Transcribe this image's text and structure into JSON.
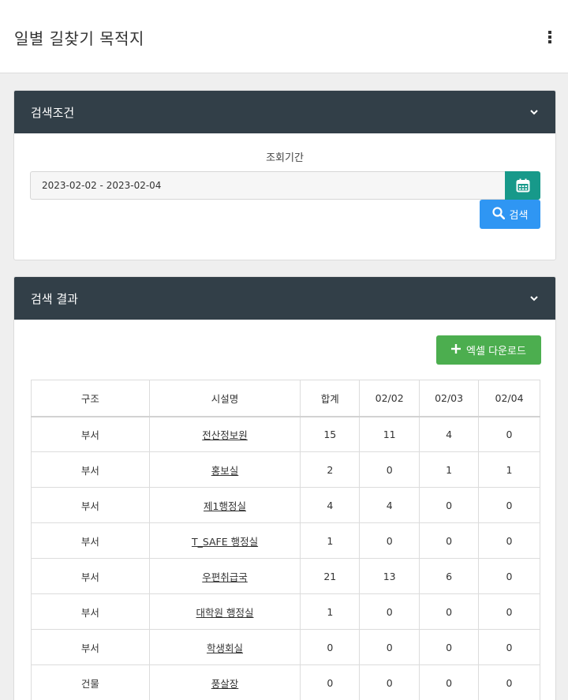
{
  "header": {
    "title": "일별 길찾기 목적지",
    "menu_icon": "kebab-menu-icon"
  },
  "search_panel": {
    "title": "검색조건",
    "period_label": "조회기간",
    "date_range_value": "2023-02-02 - 2023-02-04",
    "calendar_icon": "calendar-icon",
    "search_button_label": "검색",
    "search_icon": "search-icon"
  },
  "results_panel": {
    "title": "검색 결과",
    "excel_button_label": "엑셀 다운로드",
    "excel_icon": "plus-icon",
    "columns": [
      "구조",
      "시설명",
      "합계",
      "02/02",
      "02/03",
      "02/04"
    ],
    "rows": [
      {
        "type": "부서",
        "name": "전산정보원",
        "total": "15",
        "d1": "11",
        "d2": "4",
        "d3": "0"
      },
      {
        "type": "부서",
        "name": "홍보실",
        "total": "2",
        "d1": "0",
        "d2": "1",
        "d3": "1"
      },
      {
        "type": "부서",
        "name": "제1행정실",
        "total": "4",
        "d1": "4",
        "d2": "0",
        "d3": "0"
      },
      {
        "type": "부서",
        "name": "T_SAFE 행정실",
        "total": "1",
        "d1": "0",
        "d2": "0",
        "d3": "0"
      },
      {
        "type": "부서",
        "name": "우편취급국",
        "total": "21",
        "d1": "13",
        "d2": "6",
        "d3": "0"
      },
      {
        "type": "부서",
        "name": "대학원 행정실",
        "total": "1",
        "d1": "0",
        "d2": "0",
        "d3": "0"
      },
      {
        "type": "부서",
        "name": "학생회실",
        "total": "0",
        "d1": "0",
        "d2": "0",
        "d3": "0"
      },
      {
        "type": "건물",
        "name": "풍살장",
        "total": "0",
        "d1": "0",
        "d2": "0",
        "d3": "0"
      }
    ]
  },
  "colors": {
    "panel_header": "#323f48",
    "calendar_button": "#17998a",
    "search_button": "#2f96f3",
    "excel_button": "#4cae4f"
  }
}
